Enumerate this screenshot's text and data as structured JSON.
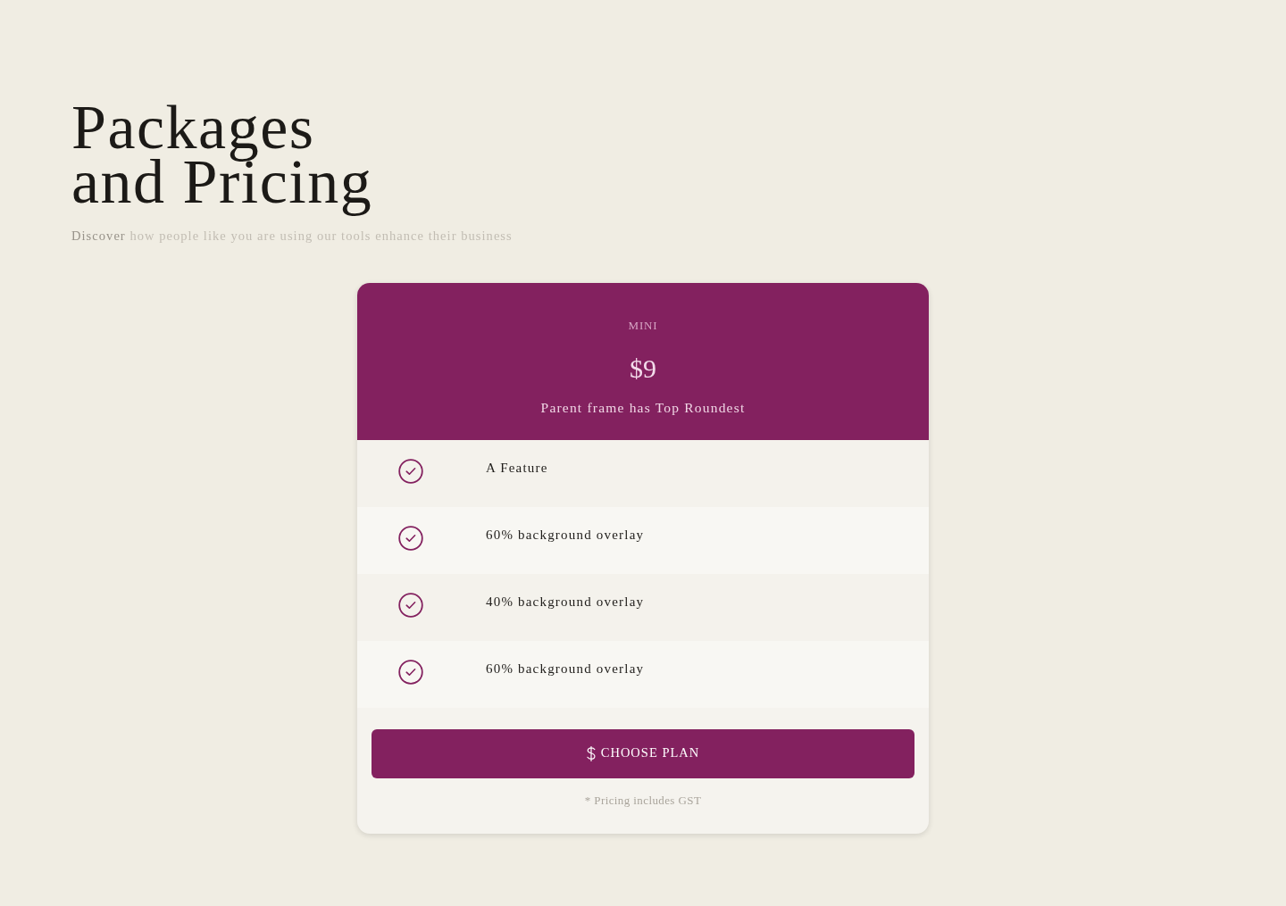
{
  "heading": {
    "lines": [
      "Packages",
      "and Pricing"
    ]
  },
  "subtitle": {
    "lead": "Discover",
    "text": "how people like you are using our tools enhance their business"
  },
  "plan": {
    "name": "MINI",
    "price": "$9",
    "note": "Parent frame has Top Roundest",
    "features": [
      "A Feature",
      "60% background overlay",
      "40% background overlay",
      "60% background overlay"
    ],
    "button": "CHOOSE PLAN",
    "footnote": "* Pricing includes GST"
  }
}
